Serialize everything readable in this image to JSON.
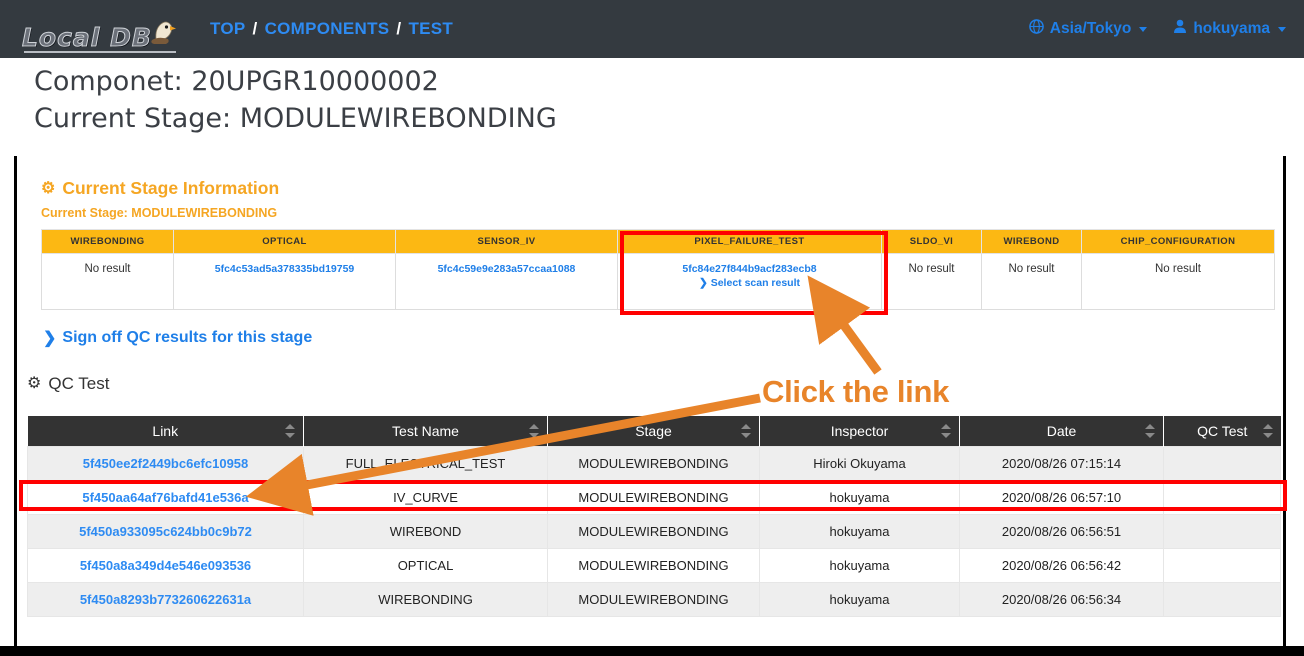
{
  "navbar": {
    "logo_text": "Local DB",
    "logo_icon": "eagle-icon",
    "breadcrumb": [
      {
        "label": "TOP"
      },
      {
        "label": "COMPONENTS"
      },
      {
        "label": "TEST"
      }
    ],
    "separator": "/",
    "timezone": {
      "icon": "globe-icon",
      "label": "Asia/Tokyo"
    },
    "user": {
      "icon": "user-icon",
      "label": "hokuyama"
    }
  },
  "header": {
    "component_line": "Componet: 20UPGR10000002",
    "stage_line": "Current Stage: MODULEWIREBONDING"
  },
  "stage_section": {
    "gear_icon": "gear-icon",
    "title": "Current Stage Information",
    "current_stage": "Current Stage: MODULEWIREBONDING",
    "columns": [
      "WIREBONDING",
      "OPTICAL",
      "SENSOR_IV",
      "PIXEL_FAILURE_TEST",
      "SLDO_VI",
      "WIREBOND",
      "CHIP_CONFIGURATION"
    ],
    "cells": [
      {
        "type": "text",
        "value": "No result"
      },
      {
        "type": "link",
        "value": "5fc4c53ad5a378335bd19759"
      },
      {
        "type": "link",
        "value": "5fc4c59e9e283a57ccaa1088"
      },
      {
        "type": "link",
        "value": "5fc84e27f844b9acf283ecb8",
        "action": "Select scan result",
        "chevron": "chevron-right-icon"
      },
      {
        "type": "text",
        "value": "No result"
      },
      {
        "type": "text",
        "value": "No result"
      },
      {
        "type": "text",
        "value": "No result"
      }
    ],
    "signoff": {
      "chevron": "chevron-right-icon",
      "label": "Sign off QC results for this stage"
    }
  },
  "qc_section": {
    "gear_icon": "gear-icon",
    "title": "QC Test",
    "columns": [
      {
        "label": "Link",
        "sort_icon": "sort-icon"
      },
      {
        "label": "Test Name",
        "sort_icon": "sort-icon"
      },
      {
        "label": "Stage",
        "sort_icon": "sort-icon"
      },
      {
        "label": "Inspector",
        "sort_icon": "sort-icon"
      },
      {
        "label": "Date",
        "sort_icon": "sort-icon"
      },
      {
        "label": "QC Test",
        "sort_icon": "sort-icon"
      }
    ],
    "rows": [
      {
        "link": "5f450ee2f2449bc6efc10958",
        "test_name": "FULL_ELECTRICAL_TEST",
        "stage": "MODULEWIREBONDING",
        "inspector": "Hiroki Okuyama",
        "date": "2020/08/26 07:15:14",
        "qc_test": ""
      },
      {
        "link": "5f450aa64af76bafd41e536a",
        "test_name": "IV_CURVE",
        "stage": "MODULEWIREBONDING",
        "inspector": "hokuyama",
        "date": "2020/08/26 06:57:10",
        "qc_test": ""
      },
      {
        "link": "5f450a933095c624bb0c9b72",
        "test_name": "WIREBOND",
        "stage": "MODULEWIREBONDING",
        "inspector": "hokuyama",
        "date": "2020/08/26 06:56:51",
        "qc_test": ""
      },
      {
        "link": "5f450a8a349d4e546e093536",
        "test_name": "OPTICAL",
        "stage": "MODULEWIREBONDING",
        "inspector": "hokuyama",
        "date": "2020/08/26 06:56:42",
        "qc_test": ""
      },
      {
        "link": "5f450a8293b773260622631a",
        "test_name": "WIREBONDING",
        "stage": "MODULEWIREBONDING",
        "inspector": "hokuyama",
        "date": "2020/08/26 06:56:34",
        "qc_test": ""
      }
    ]
  },
  "annotations": {
    "instruction": "Click the link",
    "highlight_color": "#ff0000",
    "arrow_color": "#e8842a"
  }
}
